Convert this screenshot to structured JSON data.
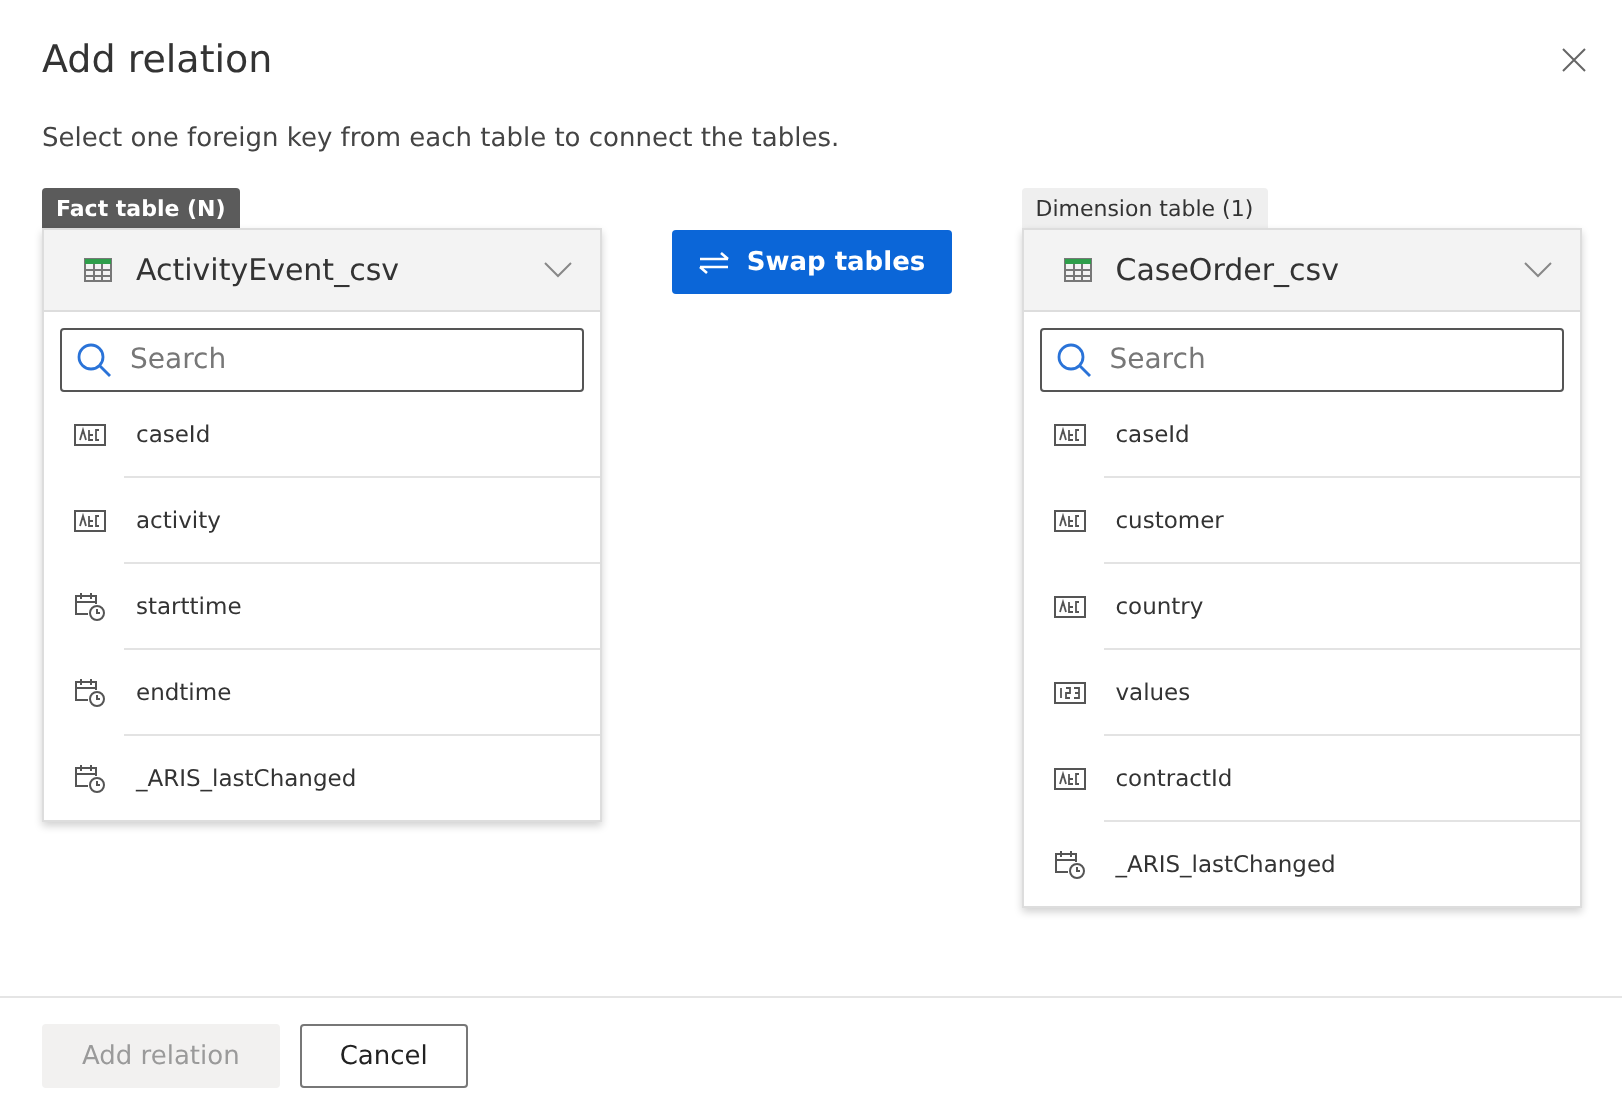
{
  "dialog": {
    "title": "Add relation",
    "description": "Select one foreign key from each table to connect the tables."
  },
  "swap_button": {
    "label": "Swap tables"
  },
  "tables": [
    {
      "tag": "Fact table (N)",
      "tag_active": true,
      "name": "ActivityEvent_csv",
      "search": {
        "placeholder": "Search"
      },
      "columns": [
        {
          "name": "caseId",
          "kind": "text"
        },
        {
          "name": "activity",
          "kind": "text"
        },
        {
          "name": "starttime",
          "kind": "datetime"
        },
        {
          "name": "endtime",
          "kind": "datetime"
        },
        {
          "name": "_ARIS_lastChanged",
          "kind": "datetime"
        }
      ]
    },
    {
      "tag": "Dimension table (1)",
      "tag_active": false,
      "name": "CaseOrder_csv",
      "search": {
        "placeholder": "Search"
      },
      "columns": [
        {
          "name": "caseId",
          "kind": "text"
        },
        {
          "name": "customer",
          "kind": "text"
        },
        {
          "name": "country",
          "kind": "text"
        },
        {
          "name": "values",
          "kind": "number"
        },
        {
          "name": "contractId",
          "kind": "text"
        },
        {
          "name": "_ARIS_lastChanged",
          "kind": "datetime"
        }
      ]
    }
  ],
  "footer": {
    "buttons": [
      {
        "label": "Add relation",
        "disabled": true
      },
      {
        "label": "Cancel",
        "disabled": false
      }
    ]
  }
}
